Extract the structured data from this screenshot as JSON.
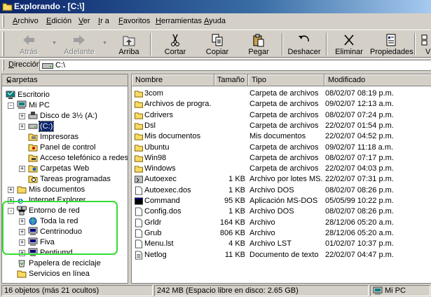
{
  "window": {
    "title": "Explorando - [C:\\]"
  },
  "menu": [
    "Archivo",
    "Edición",
    "Ver",
    "Ir a",
    "Favoritos",
    "Herramientas",
    "Ayuda"
  ],
  "toolbar": {
    "back": "Atrás",
    "forward": "Adelante",
    "up": "Arriba",
    "cut": "Cortar",
    "copy": "Copiar",
    "paste": "Pegar",
    "undo": "Deshacer",
    "delete": "Eliminar",
    "properties": "Propiedades",
    "views": "V"
  },
  "address": {
    "label": "Dirección",
    "value": "C:\\"
  },
  "folders_pane": {
    "title": "Carpetas",
    "close": "×",
    "tree": [
      {
        "label": "Escritorio",
        "icon": "desktop-icon",
        "level": 0,
        "expander": ""
      },
      {
        "label": "Mi PC",
        "icon": "my-computer-icon",
        "level": 1,
        "expander": "-"
      },
      {
        "label": "Disco de 3½ (A:)",
        "icon": "floppy-icon",
        "level": 2,
        "expander": "+"
      },
      {
        "label": "(C:)",
        "icon": "hard-drive-icon",
        "level": 2,
        "expander": "+",
        "selected": true
      },
      {
        "label": "Impresoras",
        "icon": "printer-folder-icon",
        "level": 2,
        "expander": ""
      },
      {
        "label": "Panel de control",
        "icon": "control-panel-icon",
        "level": 2,
        "expander": ""
      },
      {
        "label": "Acceso telefónico a redes",
        "icon": "dialup-icon",
        "level": 2,
        "expander": ""
      },
      {
        "label": "Carpetas Web",
        "icon": "web-folder-icon",
        "level": 2,
        "expander": "+"
      },
      {
        "label": "Tareas programadas",
        "icon": "scheduled-tasks-icon",
        "level": 2,
        "expander": ""
      },
      {
        "label": "Mis documentos",
        "icon": "folder-icon",
        "level": 1,
        "expander": "+"
      },
      {
        "label": "Internet Explorer",
        "icon": "ie-icon",
        "level": 1,
        "expander": "+"
      },
      {
        "label": "Entorno de red",
        "icon": "network-icon",
        "level": 1,
        "expander": "-"
      },
      {
        "label": "Toda la red",
        "icon": "network-globe-icon",
        "level": 2,
        "expander": "+"
      },
      {
        "label": "Centrinoduo",
        "icon": "network-computer-icon",
        "level": 2,
        "expander": "+"
      },
      {
        "label": "Fiva",
        "icon": "network-computer-icon",
        "level": 2,
        "expander": "+"
      },
      {
        "label": "Pentiumd",
        "icon": "network-computer-icon",
        "level": 2,
        "expander": "+"
      },
      {
        "label": "Papelera de reciclaje",
        "icon": "recycle-bin-icon",
        "level": 1,
        "expander": ""
      },
      {
        "label": "Servicios en línea",
        "icon": "folder-icon",
        "level": 1,
        "expander": ""
      }
    ]
  },
  "columns": [
    "Nombre",
    "Tamaño",
    "Tipo",
    "Modificado"
  ],
  "files": [
    {
      "name": "3com",
      "size": "",
      "type": "Carpeta de archivos",
      "modified": "08/02/07 08:19 p.m.",
      "icon": "folder-icon"
    },
    {
      "name": "Archivos de progra...",
      "size": "",
      "type": "Carpeta de archivos",
      "modified": "09/02/07 12:13 a.m.",
      "icon": "folder-icon"
    },
    {
      "name": "Cdrivers",
      "size": "",
      "type": "Carpeta de archivos",
      "modified": "08/02/07 07:24 p.m.",
      "icon": "folder-icon"
    },
    {
      "name": "Dsl",
      "size": "",
      "type": "Carpeta de archivos",
      "modified": "22/02/07 01:54 p.m.",
      "icon": "folder-icon"
    },
    {
      "name": "Mis documentos",
      "size": "",
      "type": "Mis documentos",
      "modified": "22/02/07 04:52 p.m.",
      "icon": "folder-icon"
    },
    {
      "name": "Ubuntu",
      "size": "",
      "type": "Carpeta de archivos",
      "modified": "09/02/07 11:18 a.m.",
      "icon": "folder-icon"
    },
    {
      "name": "Win98",
      "size": "",
      "type": "Carpeta de archivos",
      "modified": "08/02/07 07:17 p.m.",
      "icon": "folder-icon"
    },
    {
      "name": "Windows",
      "size": "",
      "type": "Carpeta de archivos",
      "modified": "22/02/07 04:03 p.m.",
      "icon": "folder-icon"
    },
    {
      "name": "Autoexec",
      "size": "1 KB",
      "type": "Archivo por lotes MS...",
      "modified": "22/02/07 07:31 p.m.",
      "icon": "batch-file-icon"
    },
    {
      "name": "Autoexec.dos",
      "size": "1 KB",
      "type": "Archivo DOS",
      "modified": "08/02/07 08:26 p.m.",
      "icon": "file-icon"
    },
    {
      "name": "Command",
      "size": "95 KB",
      "type": "Aplicación MS-DOS",
      "modified": "05/05/99 10:22 p.m.",
      "icon": "msdos-app-icon"
    },
    {
      "name": "Config.dos",
      "size": "1 KB",
      "type": "Archivo DOS",
      "modified": "08/02/07 08:26 p.m.",
      "icon": "file-icon"
    },
    {
      "name": "Grldr",
      "size": "164 KB",
      "type": "Archivo",
      "modified": "28/12/06 05:20 a.m.",
      "icon": "file-icon"
    },
    {
      "name": "Grub",
      "size": "806 KB",
      "type": "Archivo",
      "modified": "28/12/06 05:20 a.m.",
      "icon": "file-icon"
    },
    {
      "name": "Menu.lst",
      "size": "4 KB",
      "type": "Archivo LST",
      "modified": "01/02/07 10:37 p.m.",
      "icon": "file-icon"
    },
    {
      "name": "Netlog",
      "size": "11 KB",
      "type": "Documento de texto",
      "modified": "22/02/07 04:47 p.m.",
      "icon": "text-file-icon"
    }
  ],
  "status": {
    "objects": "16 objetos (más 21 ocultos)",
    "space": "242 MB (Espacio libre en disco: 2.65 GB)",
    "location": "Mi PC"
  },
  "colors": {
    "title_start": "#0a246a",
    "title_end": "#a6caf0",
    "selection": "#0a246a",
    "highlight_ring": "#33dd33",
    "folder": "#f7d967"
  }
}
